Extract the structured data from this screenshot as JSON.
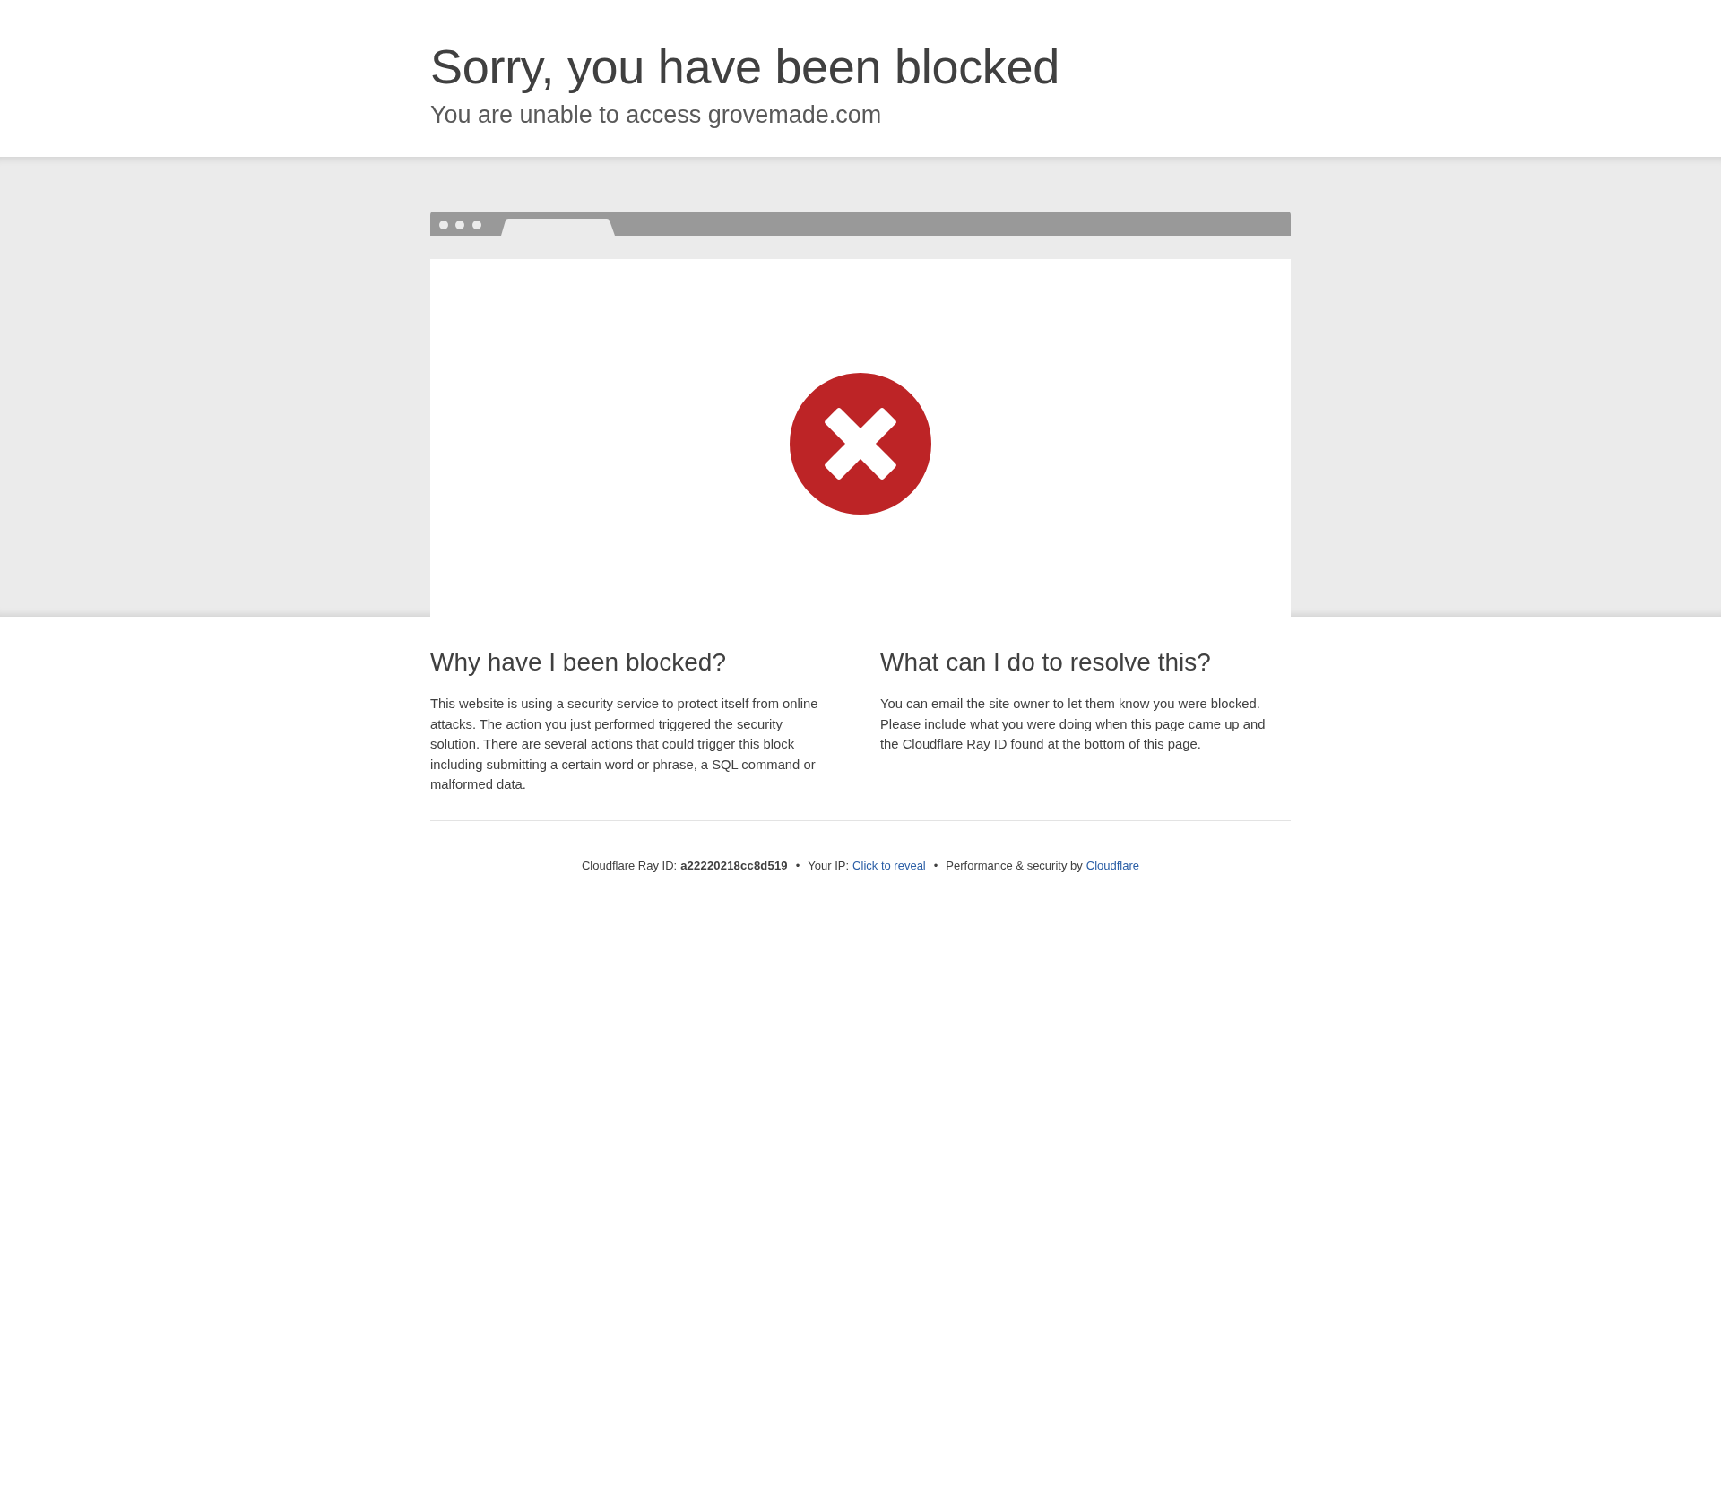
{
  "header": {
    "title": "Sorry, you have been blocked",
    "subtitle": "You are unable to access grovemade.com"
  },
  "sections": [
    {
      "heading": "Why have I been blocked?",
      "body": "This website is using a security service to protect itself from online attacks. The action you just performed triggered the security solution. There are several actions that could trigger this block including submitting a certain word or phrase, a SQL command or malformed data."
    },
    {
      "heading": "What can I do to resolve this?",
      "body": "You can email the site owner to let them know you were blocked. Please include what you were doing when this page came up and the Cloudflare Ray ID found at the bottom of this page."
    }
  ],
  "footer": [
    {
      "kind": "label",
      "text": "Cloudflare Ray ID:"
    },
    {
      "kind": "code",
      "text": "a22220218cc8d519"
    },
    {
      "kind": "separator",
      "text": "•"
    },
    {
      "kind": "label",
      "text": "Your IP:"
    },
    {
      "kind": "link",
      "text": "Click to reveal"
    },
    {
      "kind": "separator",
      "text": "•"
    },
    {
      "kind": "label",
      "text": "Performance & security by"
    },
    {
      "kind": "link",
      "text": "Cloudflare"
    }
  ]
}
